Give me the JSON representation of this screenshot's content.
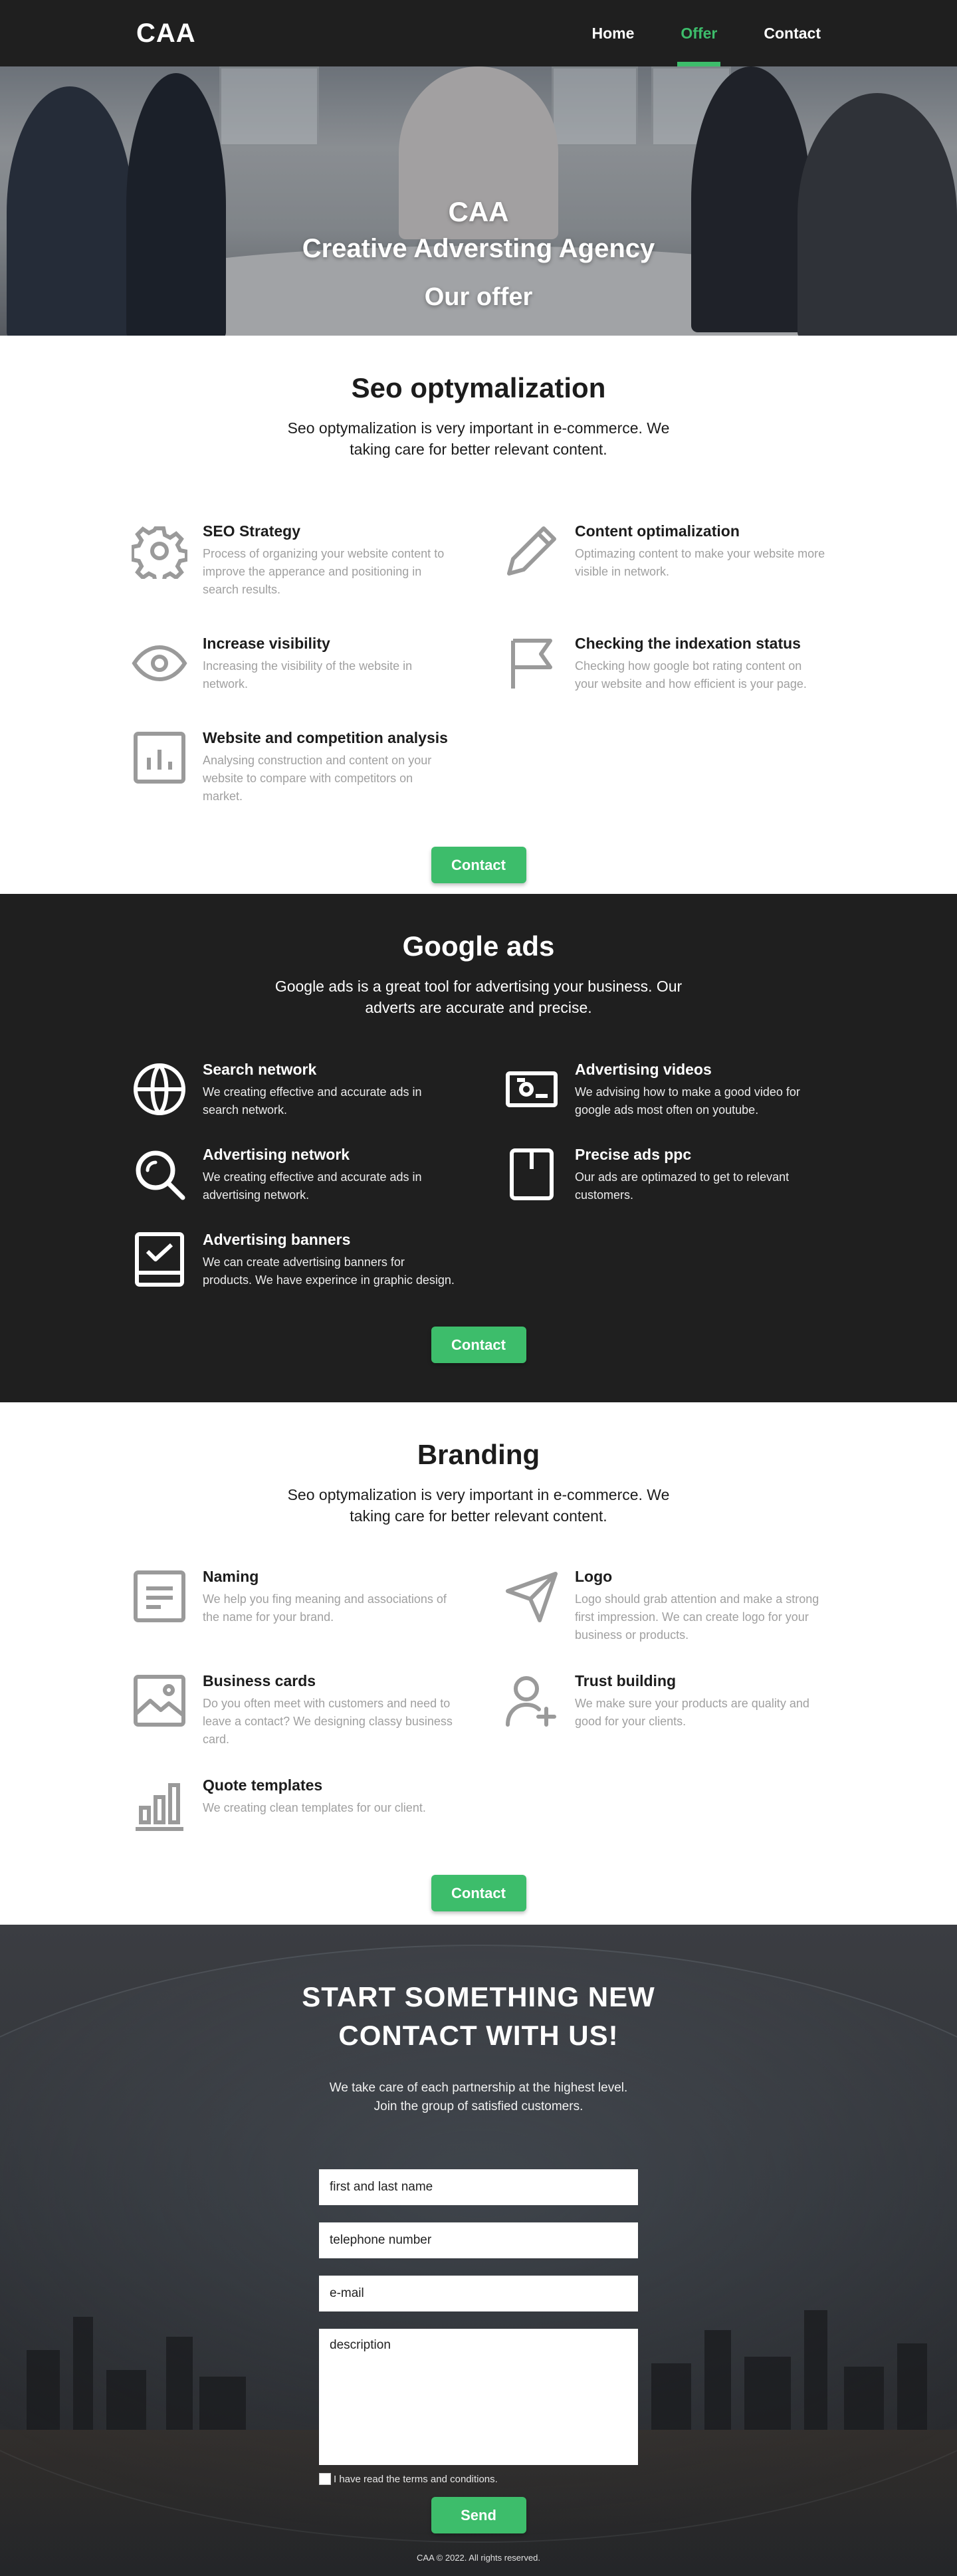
{
  "nav": {
    "logo": "CAA",
    "items": [
      {
        "label": "Home",
        "active": false
      },
      {
        "label": "Offer",
        "active": true
      },
      {
        "label": "Contact",
        "active": false
      }
    ]
  },
  "hero": {
    "line1": "CAA",
    "line2": "Creative Adversting Agency",
    "line3": "Our offer"
  },
  "seo": {
    "title": "Seo optymalization",
    "lead": "Seo optymalization is very important in e-commerce. We taking care for better relevant content.",
    "features": [
      {
        "icon": "gear-icon",
        "title": "SEO Strategy",
        "desc": "Process of organizing your website content to improve the apperance and positioning in search results."
      },
      {
        "icon": "pencil-icon",
        "title": "Content optimalization",
        "desc": "Optimazing content to make your website more visible in network."
      },
      {
        "icon": "eye-icon",
        "title": "Increase visibility",
        "desc": "Increasing the visibility of the website in network."
      },
      {
        "icon": "flag-icon",
        "title": "Checking the indexation status",
        "desc": "Checking how google bot rating content on your website and how efficient is your page."
      },
      {
        "icon": "chart-icon",
        "title": "Website and competition analysis",
        "desc": "Analysing construction and content on your website to compare with competitors on market."
      }
    ],
    "button": "Contact"
  },
  "ads": {
    "title": "Google ads",
    "lead": "Google ads is a great tool for advertising your business. Our adverts are accurate and precise.",
    "features": [
      {
        "icon": "globe-icon",
        "title": "Search network",
        "desc": "We creating effective and accurate ads in search network."
      },
      {
        "icon": "video-icon",
        "title": "Advertising videos",
        "desc": "We advising how to make a good video for google ads most often on youtube."
      },
      {
        "icon": "magnifier-icon",
        "title": "Advertising network",
        "desc": "We creating effective and accurate ads in advertising network."
      },
      {
        "icon": "bookmark-icon",
        "title": "Precise ads ppc",
        "desc": "Our ads are optimazed to get to relevant customers."
      },
      {
        "icon": "checkbox-icon",
        "title": "Advertising banners",
        "desc": "We can create advertising banners for products. We have experince in graphic design."
      }
    ],
    "button": "Contact"
  },
  "branding": {
    "title": "Branding",
    "lead": "Seo optymalization is very important in e-commerce. We taking care for better relevant content.",
    "features": [
      {
        "icon": "document-icon",
        "title": "Naming",
        "desc": "We help you fing meaning and associations of the name for your brand."
      },
      {
        "icon": "send-icon",
        "title": "Logo",
        "desc": "Logo should grab attention and make a strong first impression. We can create logo for your business or products."
      },
      {
        "icon": "image-icon",
        "title": "Business cards",
        "desc": "Do you often meet with customers and need to leave a contact? We designing classy business card."
      },
      {
        "icon": "user-plus-icon",
        "title": "Trust building",
        "desc": "We make sure your products are quality and good for your clients."
      },
      {
        "icon": "bar-chart-icon",
        "title": "Quote templates",
        "desc": "We creating clean templates for our client."
      }
    ],
    "button": "Contact"
  },
  "contact": {
    "title_line1": "START SOMETHING NEW",
    "title_line2": "CONTACT WITH US!",
    "lead": "We take care of each partnership at the highest level. Join the group of satisfied customers.",
    "fields": {
      "name": "first and last name",
      "phone": "telephone number",
      "email": "e-mail",
      "description": "description"
    },
    "terms": "I have read the terms and conditions.",
    "button": "Send",
    "footer": "CAA © 2022. All rights reserved."
  },
  "colors": {
    "accent": "#3dbd6b",
    "dark": "#1f1f1f",
    "muted_text": "#a0a0a0",
    "icon_gray": "#9a9a9a"
  }
}
